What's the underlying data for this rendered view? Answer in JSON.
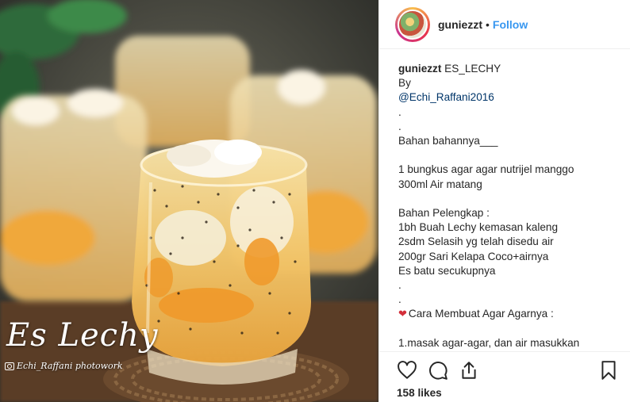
{
  "header": {
    "username": "guniezzt",
    "separator": "•",
    "follow_label": "Follow"
  },
  "photo": {
    "watermark_title": "Es Lechy",
    "watermark_credit": "Echi_Raffani photowork"
  },
  "caption": {
    "username": "guniezzt",
    "first_text": " ES_LECHY",
    "lines": [
      "By",
      "@Echi_Raffani2016",
      ".",
      ".",
      "Bahan bahannya___",
      "",
      "1 bungkus agar agar nutrijel manggo",
      "300ml Air matang",
      "",
      "Bahan Pelengkap :",
      "1bh Buah Lechy kemasan kaleng",
      "2sdm Selasih yg telah disedu air",
      "200gr Sari Kelapa Coco+airnya",
      "Es batu secukupnya",
      ".",
      ".",
      "Cara Membuat Agar Agarnya :",
      "",
      "1.masak agar-agar, dan air masukkan"
    ]
  },
  "actions": {
    "like_icon": "heart-outline-icon",
    "comment_icon": "comment-bubble-icon",
    "share_icon": "share-upload-icon",
    "save_icon": "bookmark-icon"
  },
  "likes": "158 likes",
  "colors": {
    "link": "#3897f0",
    "mention": "#003569",
    "text": "#262626",
    "divider": "#efefef"
  }
}
